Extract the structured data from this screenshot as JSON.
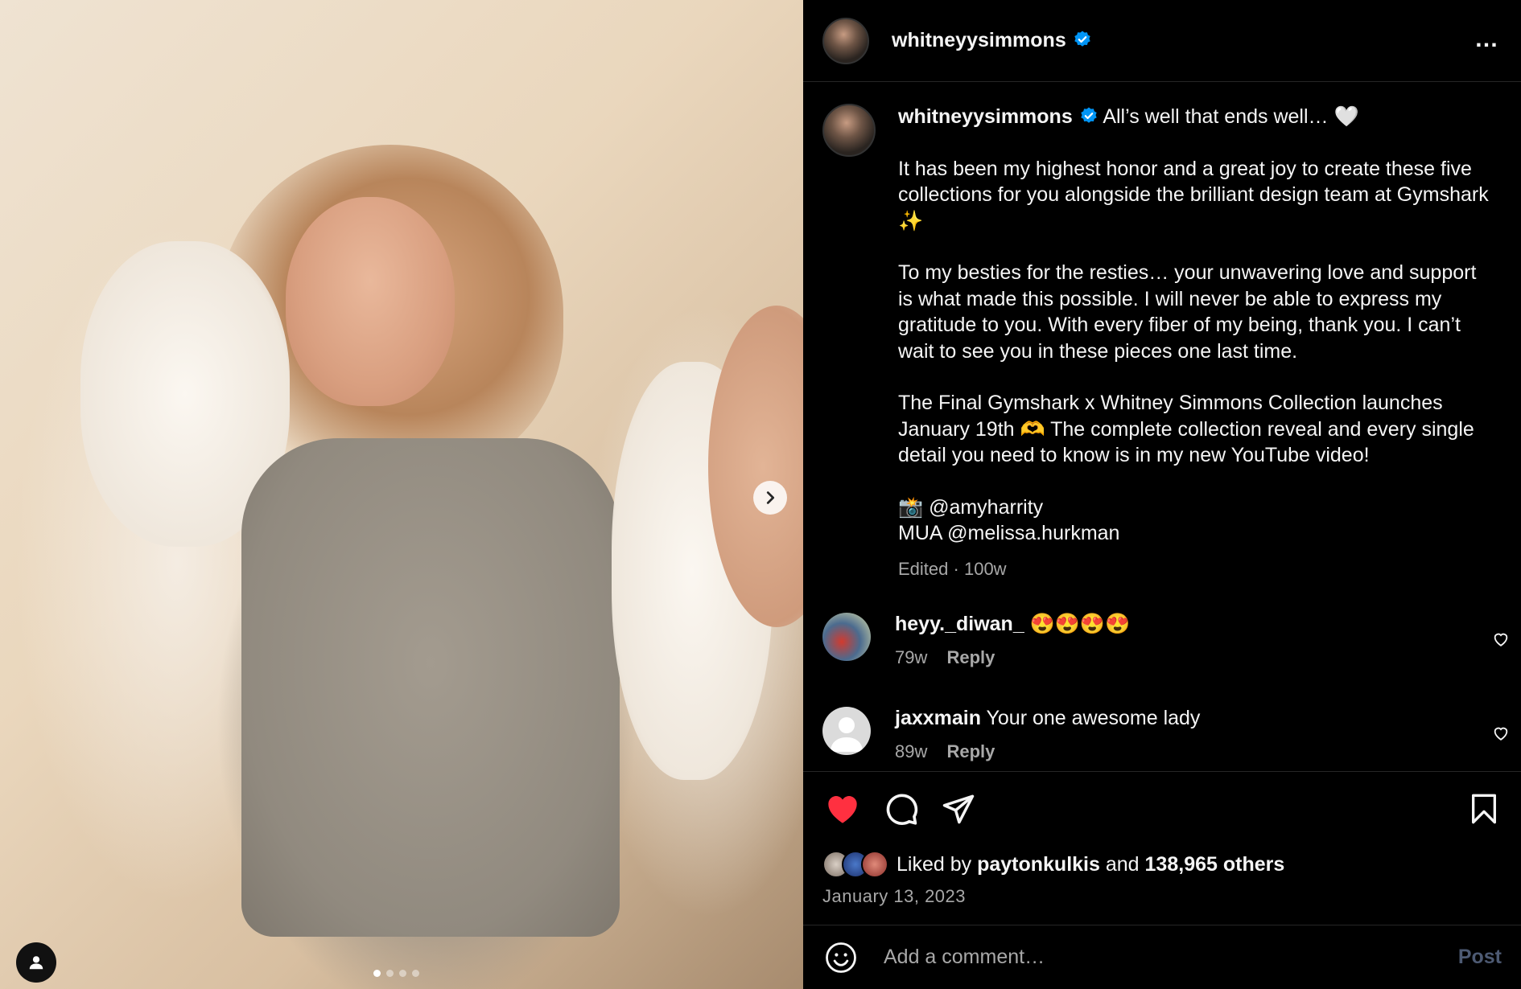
{
  "post": {
    "username": "whitneyysimmons",
    "more_icon": "…"
  },
  "caption": {
    "username": "whitneyysimmons",
    "line1": "All’s well that ends well… 🤍",
    "para1": "It has been my highest honor and a great joy to create these five collections for you alongside the brilliant design team at Gymshark ✨",
    "para2": "To my besties for the resties… your unwavering love and support is what made this possible. I will never be able to express my gratitude to you. With every fiber of my being, thank you. I can’t wait to see you in these pieces one last time.",
    "para3": "The Final Gymshark x Whitney Simmons Collection launches January 19th 🫶 The complete collection reveal and every single detail you need to know is in my new YouTube video!",
    "credit1": "📸 @amyharrity",
    "credit2": "MUA @melissa.hurkman",
    "edited": "Edited",
    "sep": "·",
    "age": "100w"
  },
  "comments": [
    {
      "username": "heyy._diwan_",
      "text": "😍😍😍😍",
      "age": "79w",
      "reply": "Reply"
    },
    {
      "username": "jaxxmain",
      "text": "Your one awesome lady",
      "age": "89w",
      "reply": "Reply"
    }
  ],
  "likes": {
    "prefix": "Liked by",
    "user": "paytonkulkis",
    "mid": "and",
    "count": "138,965 others"
  },
  "date": "January 13, 2023",
  "composer": {
    "placeholder": "Add a comment…",
    "post_label": "Post"
  },
  "carousel": {
    "total": 4,
    "current": 1
  },
  "colors": {
    "like_red": "#ff3040",
    "verified_blue": "#0095f6",
    "post_disabled": "#4d5a73"
  }
}
